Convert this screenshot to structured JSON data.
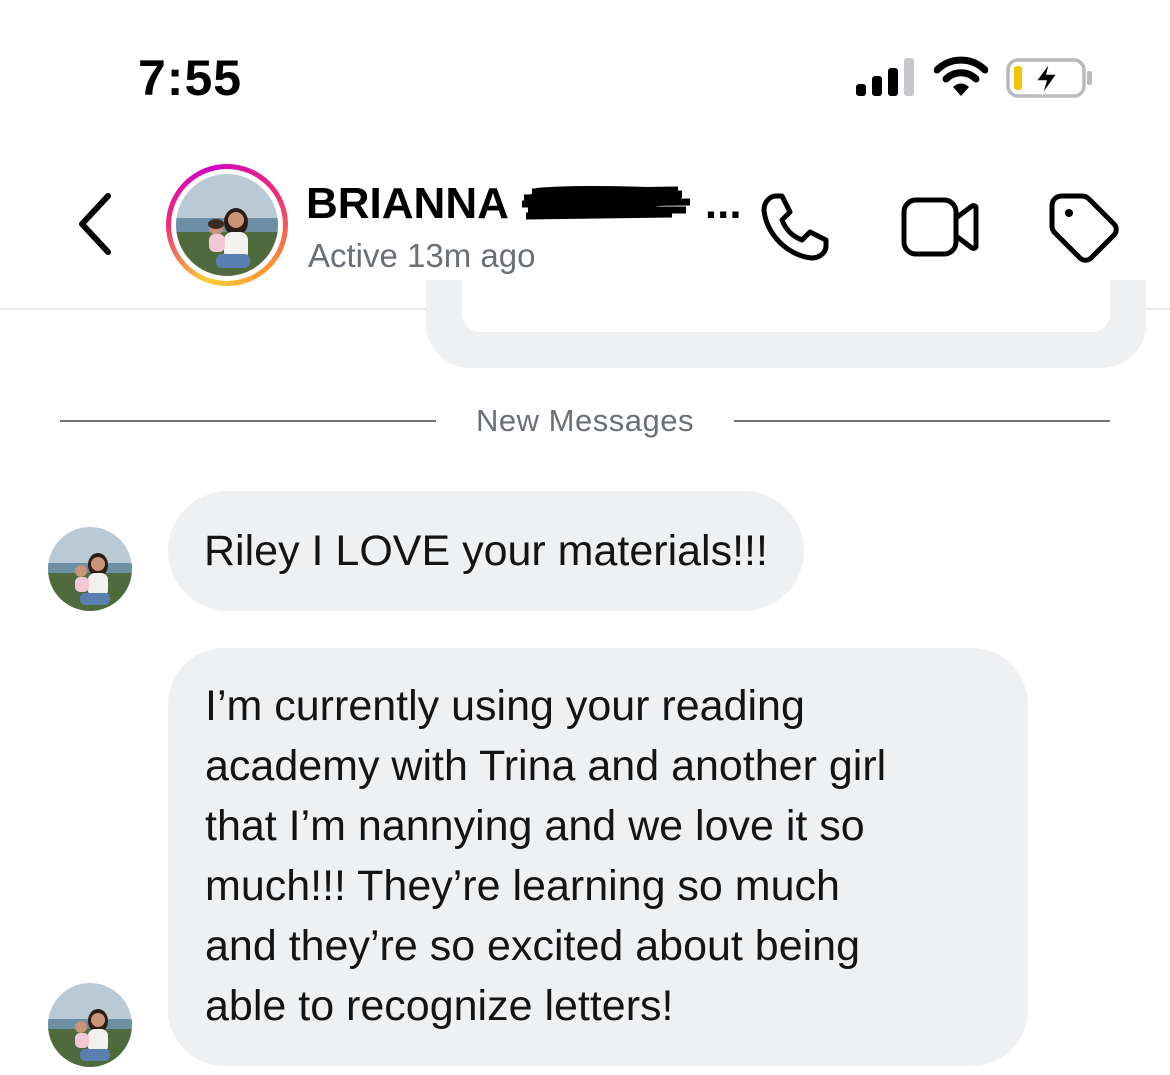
{
  "status_bar": {
    "time": "7:55",
    "icons": [
      "cellular-signal-icon",
      "wifi-icon",
      "battery-charging-icon"
    ],
    "battery_color": "#f5c400"
  },
  "header": {
    "contact_name": "BRIANNA",
    "contact_name_suffix": "...",
    "status": "Active 13m ago",
    "buttons": [
      "back-icon",
      "phone-icon",
      "video-icon",
      "tag-icon"
    ]
  },
  "divider": {
    "label": "New Messages"
  },
  "messages": [
    {
      "sender": "them",
      "lines": [
        "Riley I LOVE your materials!!!"
      ]
    },
    {
      "sender": "them",
      "lines": [
        "I’m currently using your reading",
        "academy with Trina and another girl",
        "that I’m nannying and we love it so",
        "much!!! They’re learning so much",
        "and they’re so excited about being",
        "able to recognize letters!"
      ]
    }
  ],
  "colors": {
    "bubble_bg": "#eff0f2",
    "secondary_text": "#6b6f76"
  }
}
